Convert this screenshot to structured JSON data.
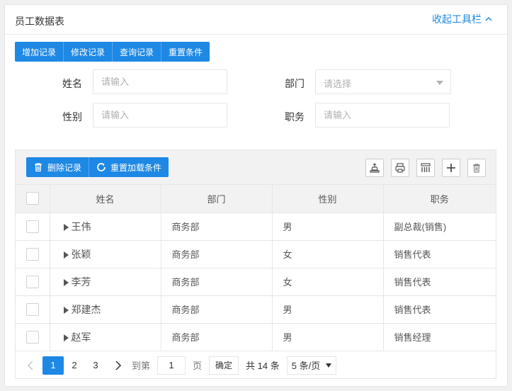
{
  "panel": {
    "title": "员工数据表",
    "collapse_label": "收起工具栏"
  },
  "actions": {
    "add": "增加记录",
    "edit": "修改记录",
    "query": "查询记录",
    "reset": "重置条件"
  },
  "form": {
    "name_label": "姓名",
    "name_placeholder": "请输入",
    "dept_label": "部门",
    "dept_placeholder": "请选择",
    "gender_label": "性别",
    "gender_placeholder": "请输入",
    "position_label": "职务",
    "position_placeholder": "请输入"
  },
  "toolbar": {
    "delete": "删除记录",
    "reload": "重置加载条件",
    "icons": [
      "export-icon",
      "print-icon",
      "columns-icon",
      "add-icon",
      "trash-icon"
    ]
  },
  "table": {
    "headers": [
      "姓名",
      "部门",
      "性别",
      "职务"
    ],
    "rows": [
      {
        "name": "王伟",
        "dept": "商务部",
        "gender": "男",
        "position": "副总裁(销售)"
      },
      {
        "name": "张颖",
        "dept": "商务部",
        "gender": "女",
        "position": "销售代表"
      },
      {
        "name": "李芳",
        "dept": "商务部",
        "gender": "女",
        "position": "销售代表"
      },
      {
        "name": "郑建杰",
        "dept": "商务部",
        "gender": "男",
        "position": "销售代表"
      },
      {
        "name": "赵军",
        "dept": "商务部",
        "gender": "男",
        "position": "销售经理"
      }
    ]
  },
  "pager": {
    "pages": [
      "1",
      "2",
      "3"
    ],
    "current": "1",
    "goto_label": "到第",
    "goto_value": "1",
    "page_unit": "页",
    "confirm": "确定",
    "total": "共 14 条",
    "page_size": "5 条/页"
  },
  "colors": {
    "primary": "#1e88e5",
    "header_bg": "#f2f2f2"
  }
}
